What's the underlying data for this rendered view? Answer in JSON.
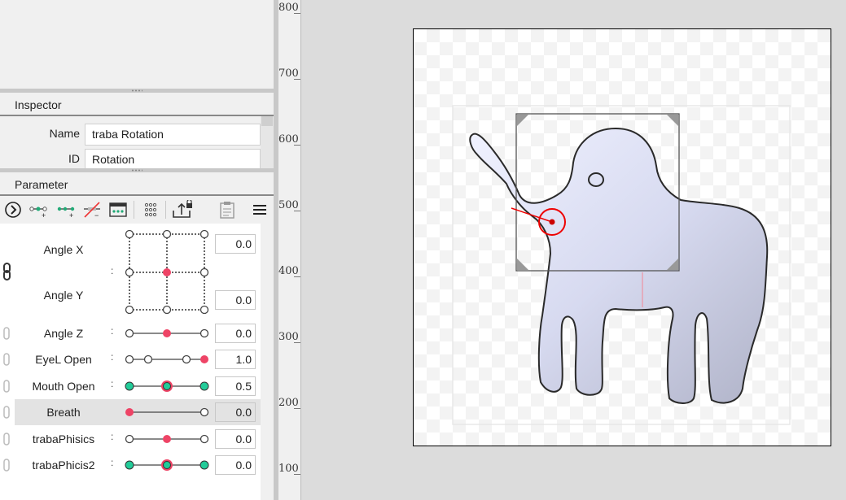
{
  "inspector": {
    "title": "Inspector",
    "name_label": "Name",
    "name_value": "traba Rotation",
    "id_label": "ID",
    "id_value": "Rotation"
  },
  "parameter": {
    "title": "Parameter",
    "toolbar": [
      "play-forward-icon",
      "add-key-icon",
      "add-keys-icon",
      "delete-key-icon",
      "keyform-panel-icon",
      "grid-dots-icon",
      "export-lock-icon",
      "clipboard-icon",
      "menu-icon"
    ],
    "angle_x": {
      "name": "Angle X",
      "value": "0.0"
    },
    "angle_y": {
      "name": "Angle Y",
      "value": "0.0"
    },
    "colon": ":",
    "rows": [
      {
        "name": "Angle Z",
        "value": "0.0",
        "keys": 3,
        "active": 1,
        "style": "red"
      },
      {
        "name": "EyeL Open",
        "value": "1.0",
        "keys": 4,
        "active": 3,
        "style": "red"
      },
      {
        "name": "Mouth Open",
        "value": "0.5",
        "keys": 3,
        "active": 1,
        "style": "green"
      },
      {
        "name": "Breath",
        "value": "0.0",
        "keys": 2,
        "active": 0,
        "style": "red"
      },
      {
        "name": "trabaPhisics",
        "value": "0.0",
        "keys": 3,
        "active": 1,
        "style": "red"
      },
      {
        "name": "trabaPhicis2",
        "value": "0.0",
        "keys": 3,
        "active": 1,
        "style": "green"
      }
    ]
  },
  "ruler": {
    "ticks": [
      "800",
      "700",
      "600",
      "500",
      "400",
      "300",
      "200",
      "100"
    ]
  },
  "colors": {
    "key_active": "#ee4466",
    "key_green": "#22cc99",
    "rotation_handle": "#ee0000"
  }
}
